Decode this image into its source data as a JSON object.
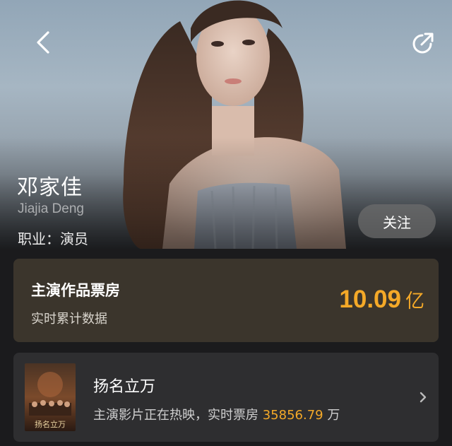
{
  "header": {
    "back_icon": "chevron-left-icon",
    "share_icon": "share-icon"
  },
  "profile": {
    "name_cn": "邓家佳",
    "name_en": "Jiajia Deng",
    "profession": "职业：演员",
    "follow_label": "关注"
  },
  "box_office": {
    "title": "主演作品票房",
    "subtitle": "实时累计数据",
    "amount": "10.09",
    "unit": "亿",
    "accent_color": "#f4a928"
  },
  "movie": {
    "title": "扬名立万",
    "status_text": "主演影片正在热映，实时票房",
    "box_office_value": "35856.79",
    "box_office_unit": "万",
    "poster_text": "扬名立万",
    "chevron_icon": "chevron-right-icon"
  }
}
